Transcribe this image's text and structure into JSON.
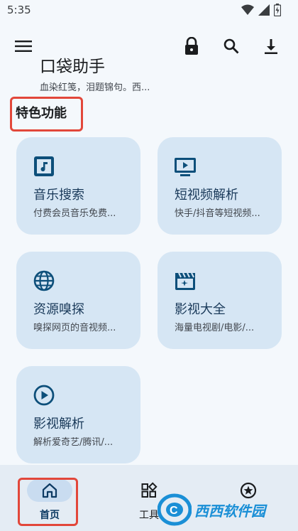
{
  "status": {
    "time": "5:35"
  },
  "app": {
    "title": "口袋助手",
    "subtitle": "血染红笺，泪题锦句。西..."
  },
  "section": {
    "title": "特色功能"
  },
  "cards": [
    {
      "title": "音乐搜索",
      "subtitle": "付费会员音乐免费...",
      "icon": "music-note-icon"
    },
    {
      "title": "短视频解析",
      "subtitle": "快手/抖音等短视频...",
      "icon": "tv-play-icon"
    },
    {
      "title": "资源嗅探",
      "subtitle": "嗅探网页的音视频...",
      "icon": "globe-icon"
    },
    {
      "title": "影视大全",
      "subtitle": "海量电视剧/电影/...",
      "icon": "movie-clapper-icon"
    },
    {
      "title": "影视解析",
      "subtitle": "解析爱奇艺/腾讯/...",
      "icon": "play-circle-icon"
    }
  ],
  "nav": {
    "items": [
      {
        "label": "首页",
        "icon": "home-icon",
        "active": true
      },
      {
        "label": "工具",
        "icon": "widgets-icon",
        "active": false
      },
      {
        "label": "",
        "icon": "star-circle-icon",
        "active": false
      }
    ]
  },
  "watermark": {
    "text": "西西软件园"
  },
  "colors": {
    "accent": "#0d4f7a",
    "card": "#d6e6f4",
    "highlight": "#e2473a"
  }
}
